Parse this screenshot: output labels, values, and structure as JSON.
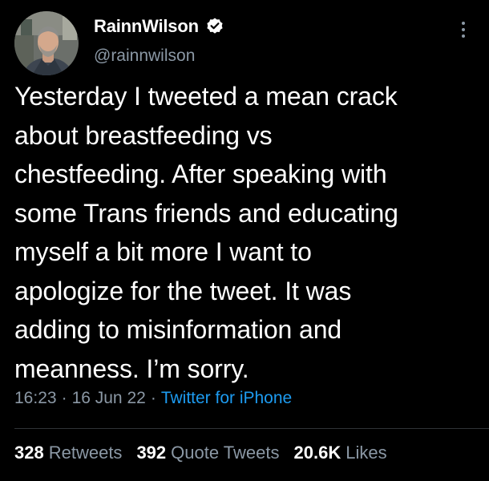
{
  "author": {
    "display_name": "RainnWilson",
    "handle": "@rainnwilson",
    "verified": true
  },
  "tweet": {
    "lines": [
      "Yesterday I tweeted a mean crack",
      "about breastfeeding vs",
      "chestfeeding. After speaking with",
      "some Trans friends and educating",
      "myself a bit more I want to",
      "apologize for the tweet. It was",
      "adding to misinformation and",
      "meanness. I’m sorry."
    ],
    "time": "16:23",
    "separator": "·",
    "date": "16 Jun 22",
    "source": "Twitter for iPhone"
  },
  "stats": {
    "retweets_count": "328",
    "retweets_label": "Retweets",
    "quotes_count": "392",
    "quotes_label": "Quote Tweets",
    "likes_count": "20.6K",
    "likes_label": "Likes"
  },
  "colors": {
    "background": "#000000",
    "text": "#ffffff",
    "secondary": "#8b98a5",
    "link": "#1d9bf0",
    "divider": "#2f3336"
  },
  "icons": {
    "verified": "verified-badge-icon",
    "more": "more-options-icon"
  }
}
